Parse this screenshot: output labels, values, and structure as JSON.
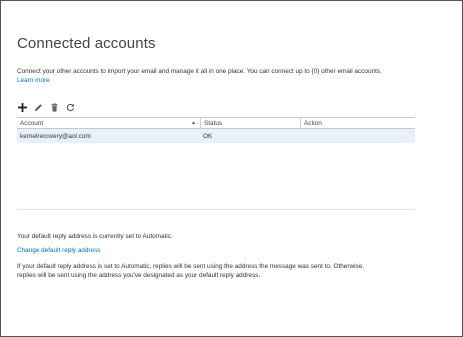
{
  "page": {
    "title": "Connected accounts",
    "description": "Connect your other accounts to import your email and manage it all in one place. You can connect up to {0} other email accounts.",
    "learn_more": "Learn more"
  },
  "toolbar": {
    "add_icon": "plus-icon",
    "edit_icon": "pencil-icon",
    "delete_icon": "trash-icon",
    "refresh_icon": "refresh-icon"
  },
  "table": {
    "columns": [
      "Account",
      "Status",
      "Action"
    ],
    "rows": [
      {
        "account": "kernelrecovery@aol.com",
        "status": "OK",
        "action": ""
      }
    ]
  },
  "reply": {
    "status_text": "Your default reply address is currently set to Automatic.",
    "change_link": "Change default reply address",
    "description": "If your default reply address is set to Automatic, replies will be sent using the address the message was sent to. Otherwise, replies will be sent using the address you've designated as your default reply address."
  },
  "colors": {
    "link": "#0072c6",
    "selected_row": "#e8f1fb",
    "border": "#555555"
  }
}
